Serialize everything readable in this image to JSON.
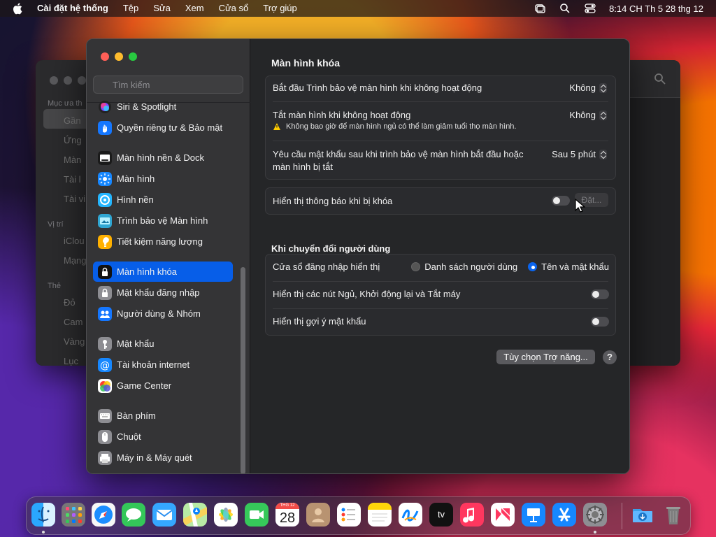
{
  "menubar": {
    "app": "Cài đặt hệ thống",
    "items": [
      "Tệp",
      "Sửa",
      "Xem",
      "Cửa sổ",
      "Trợ giúp"
    ],
    "clock": "8:14 CH Th 5 28 thg 12"
  },
  "background_window": {
    "labels": [
      "Mục ưa th",
      "Vị trí",
      "Thẻ"
    ],
    "items": [
      "Gần",
      "Ứng",
      "Màn",
      "Tài l",
      "Tài vi",
      "iClou",
      "Mạng",
      "Đỏ",
      "Cam",
      "Vàng",
      "Lục"
    ]
  },
  "sidebar": {
    "search_placeholder": "Tìm kiếm",
    "items": [
      {
        "label": "Siri & Spotlight",
        "icon": "siri-icon"
      },
      {
        "label": "Quyền riêng tư & Bảo mật",
        "icon": "hand-icon"
      },
      {
        "label": "Màn hình nền & Dock",
        "icon": "dock-icon"
      },
      {
        "label": "Màn hình",
        "icon": "display-icon"
      },
      {
        "label": "Hình nền",
        "icon": "wallpaper-icon"
      },
      {
        "label": "Trình bảo vệ Màn hình",
        "icon": "screensaver-icon"
      },
      {
        "label": "Tiết kiệm năng lượng",
        "icon": "energy-icon"
      },
      {
        "label": "Màn hình khóa",
        "icon": "lock-screen-icon"
      },
      {
        "label": "Mật khẩu đăng nhập",
        "icon": "login-password-icon"
      },
      {
        "label": "Người dùng & Nhóm",
        "icon": "users-icon"
      },
      {
        "label": "Mật khẩu",
        "icon": "key-icon"
      },
      {
        "label": "Tài khoản internet",
        "icon": "internet-accounts-icon"
      },
      {
        "label": "Game Center",
        "icon": "game-center-icon"
      },
      {
        "label": "Bàn phím",
        "icon": "keyboard-icon"
      },
      {
        "label": "Chuột",
        "icon": "mouse-icon"
      },
      {
        "label": "Máy in & Máy quét",
        "icon": "printer-icon"
      }
    ]
  },
  "content": {
    "title": "Màn hình khóa",
    "screen_saver_start": {
      "label": "Bắt đầu Trình bảo vệ màn hình khi không hoạt động",
      "value": "Không"
    },
    "display_off": {
      "label": "Tắt màn hình khi không hoạt động",
      "value": "Không",
      "warning": "Không bao giờ để màn hình ngủ có thể làm giảm tuổi thọ màn hình."
    },
    "password_required": {
      "label_line1": "Yêu cầu mật khẩu sau khi trình bảo vệ màn hình bắt đầu hoặc",
      "label_line2": "màn hình bị tắt",
      "value": "Sau 5 phút"
    },
    "locked_message": {
      "label": "Hiển thị thông báo khi bị khóa",
      "button": "Đặt..."
    },
    "switching_users": {
      "title": "Khi chuyển đổi người dùng",
      "login_window_label": "Cửa sổ đăng nhập hiển thị",
      "options": [
        "Danh sách người dùng",
        "Tên và mật khẩu"
      ],
      "sleep_restart_shutdown": "Hiển thị các nút Ngủ, Khởi động lại và Tắt máy",
      "password_hints": "Hiển thị gợi ý mật khẩu"
    },
    "accessibility_button": "Tùy chọn Trợ năng...",
    "help_button": "?"
  },
  "dock": {
    "apps": [
      "finder-icon",
      "launchpad-icon",
      "safari-icon",
      "messages-icon",
      "mail-icon",
      "maps-icon",
      "photos-icon",
      "facetime-icon",
      "calendar-icon",
      "contacts-icon",
      "reminders-icon",
      "notes-icon",
      "freeform-icon",
      "apple-tv-icon",
      "music-icon",
      "news-icon",
      "keynote-icon",
      "app-store-icon",
      "system-settings-icon",
      "downloads-folder-icon",
      "trash-icon"
    ],
    "calendar_month": "THG 12",
    "calendar_day": "28",
    "apple_tv_label": "tv"
  },
  "colors": {
    "accent": "#075ee8",
    "background_window": "#222224",
    "main_window": "#292a2d"
  }
}
